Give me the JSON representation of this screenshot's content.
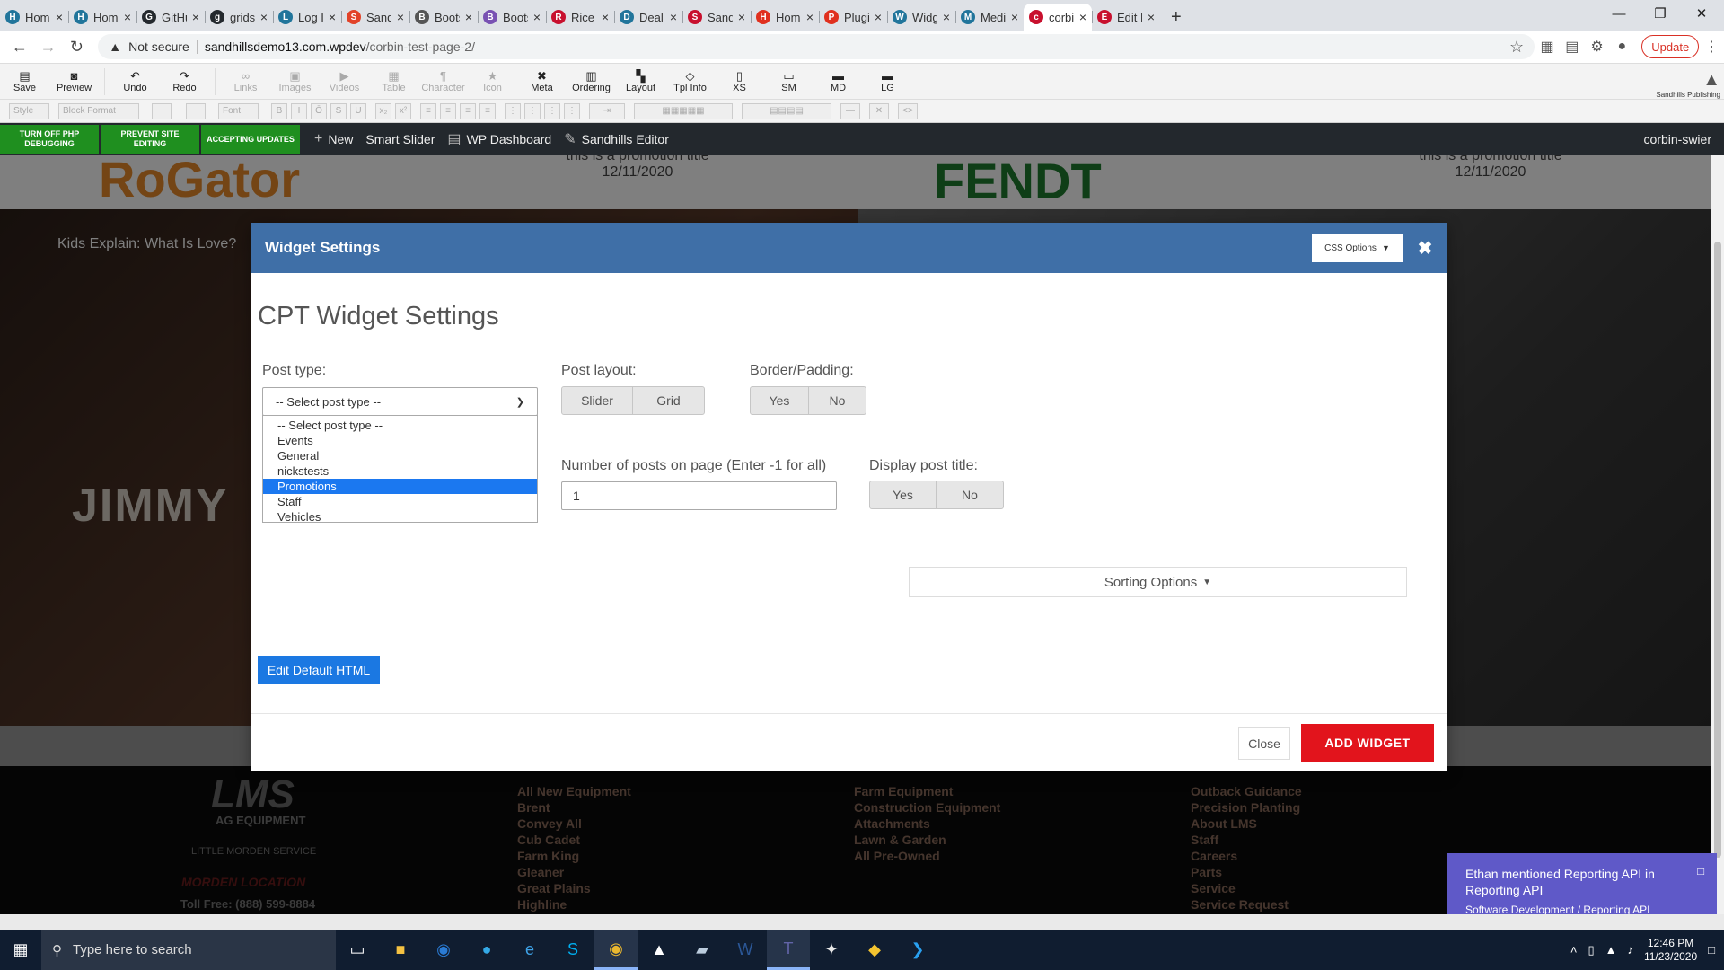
{
  "browser": {
    "tabs": [
      {
        "label": "Home",
        "favicon": "wordpress-icon",
        "color": "#21759b"
      },
      {
        "label": "Home",
        "favicon": "wordpress-icon",
        "color": "#21759b"
      },
      {
        "label": "GitHub",
        "favicon": "github-icon",
        "color": "#24292e"
      },
      {
        "label": "gridsta",
        "favicon": "github-icon",
        "color": "#24292e"
      },
      {
        "label": "Log In",
        "favicon": "wordpress-icon",
        "color": "#21759b"
      },
      {
        "label": "Sandh",
        "favicon": "gitlab-icon",
        "color": "#e24329"
      },
      {
        "label": "Bootst",
        "favicon": "document-icon",
        "color": "#555555"
      },
      {
        "label": "Bootst",
        "favicon": "bootstrap-icon",
        "color": "#7952b3"
      },
      {
        "label": "Rice A",
        "favicon": "rice-icon",
        "color": "#c8102e"
      },
      {
        "label": "Dealer",
        "favicon": "wordpress-icon",
        "color": "#21759b"
      },
      {
        "label": "Sandh",
        "favicon": "sandhills-icon",
        "color": "#c8102e"
      },
      {
        "label": "Home",
        "favicon": "k-icon",
        "color": "#e0301e"
      },
      {
        "label": "Plugin",
        "favicon": "k-icon",
        "color": "#e0301e"
      },
      {
        "label": "Widge",
        "favicon": "wordpress-icon",
        "color": "#21759b"
      },
      {
        "label": "Media",
        "favicon": "wordpress-icon",
        "color": "#21759b"
      },
      {
        "label": "corbin",
        "favicon": "sandhills-icon",
        "color": "#c8102e"
      },
      {
        "label": "Edit Pr",
        "favicon": "edit-icon",
        "color": "#c8102e"
      }
    ],
    "active_tab": 15,
    "address": {
      "warning": "Not secure",
      "domain": "sandhillsdemo13.com.wpdev",
      "path": "/corbin-test-page-2/"
    },
    "update_label": "Update"
  },
  "editor_toolbar": {
    "buttons": [
      {
        "label": "Save",
        "icon": "save-icon",
        "enabled": true
      },
      {
        "label": "Preview",
        "icon": "preview-icon",
        "enabled": true
      },
      {
        "label": "Undo",
        "icon": "undo-icon",
        "enabled": true
      },
      {
        "label": "Redo",
        "icon": "redo-icon",
        "enabled": true
      },
      {
        "label": "Links",
        "icon": "link-icon",
        "enabled": false
      },
      {
        "label": "Images",
        "icon": "image-icon",
        "enabled": false
      },
      {
        "label": "Videos",
        "icon": "video-icon",
        "enabled": false
      },
      {
        "label": "Table",
        "icon": "table-icon",
        "enabled": false
      },
      {
        "label": "Character",
        "icon": "pilcrow-icon",
        "enabled": false
      },
      {
        "label": "Icon",
        "icon": "star-icon",
        "enabled": false
      },
      {
        "label": "Meta",
        "icon": "meta-icon",
        "enabled": true
      },
      {
        "label": "Ordering",
        "icon": "ordering-icon",
        "enabled": true
      },
      {
        "label": "Layout",
        "icon": "layout-icon",
        "enabled": true
      },
      {
        "label": "Tpl Info",
        "icon": "tpl-info-icon",
        "enabled": true
      },
      {
        "label": "XS",
        "icon": "phone-icon",
        "enabled": true
      },
      {
        "label": "SM",
        "icon": "tablet-icon",
        "enabled": true
      },
      {
        "label": "MD",
        "icon": "monitor-icon",
        "enabled": true
      },
      {
        "label": "LG",
        "icon": "desktop-icon",
        "enabled": true
      }
    ],
    "format_selects": [
      "Style",
      "Block Format",
      "Font"
    ],
    "logo_text": "Sandhills Publishing"
  },
  "admin_bar": {
    "green_buttons": [
      "TURN OFF PHP DEBUGGING",
      "PREVENT SITE EDITING",
      "ACCEPTING UPDATES"
    ],
    "items": [
      "New",
      "Smart Slider",
      "WP Dashboard",
      "Sandhills Editor"
    ],
    "user": "corbin-swier"
  },
  "background_page": {
    "brand_left": "RoGator",
    "brand_right": "FENDT",
    "promo_title": "this is a promotion title",
    "promo_date": "12/11/2020",
    "video_title": "Kids Explain: What Is Love?",
    "video_text": "JIMMY",
    "footer": {
      "lms_title": "LMS",
      "lms_sub": "AG EQUIPMENT",
      "lms_tag": "LITTLE MORDEN SERVICE",
      "location": "MORDEN LOCATION",
      "toll_free": "Toll Free: (888) 599-8884",
      "new_equipment": [
        "All New Equipment",
        "Brent",
        "Convey All",
        "Cub Cadet",
        "Farm King",
        "Gleaner",
        "Great Plains",
        "Highline"
      ],
      "preowned": [
        "Farm Equipment",
        "Construction Equipment",
        "Attachments",
        "Lawn & Garden",
        "All Pre-Owned"
      ],
      "quick_links": [
        "Outback Guidance",
        "Precision Planting",
        "About LMS",
        "Staff",
        "Careers",
        "Parts",
        "Service",
        "Service Request"
      ]
    }
  },
  "modal": {
    "header_title": "Widget Settings",
    "css_options_label": "CSS Options",
    "title": "CPT Widget Settings",
    "post_type": {
      "label": "Post type:",
      "value": "-- Select post type --",
      "options": [
        "-- Select post type --",
        "Events",
        "General",
        "nickstests",
        "Promotions",
        "Staff",
        "Vehicles"
      ],
      "highlighted": "Promotions"
    },
    "post_layout": {
      "label": "Post layout:",
      "options": [
        "Slider",
        "Grid"
      ]
    },
    "border_padding": {
      "label": "Border/Padding:",
      "options": [
        "Yes",
        "No"
      ]
    },
    "num_posts": {
      "label": "Number of posts on page (Enter -1 for all)",
      "value": "1"
    },
    "display_title": {
      "label": "Display post title:",
      "options": [
        "Yes",
        "No"
      ]
    },
    "sorting_label": "Sorting Options",
    "edit_html_label": "Edit Default HTML",
    "close_label": "Close",
    "add_label": "ADD WIDGET"
  },
  "toast": {
    "title": "Ethan mentioned Reporting API in Reporting API",
    "subtitle": "Software Development / Reporting API"
  },
  "taskbar": {
    "search_placeholder": "Type here to search",
    "time": "12:46 PM",
    "date": "11/23/2020"
  }
}
